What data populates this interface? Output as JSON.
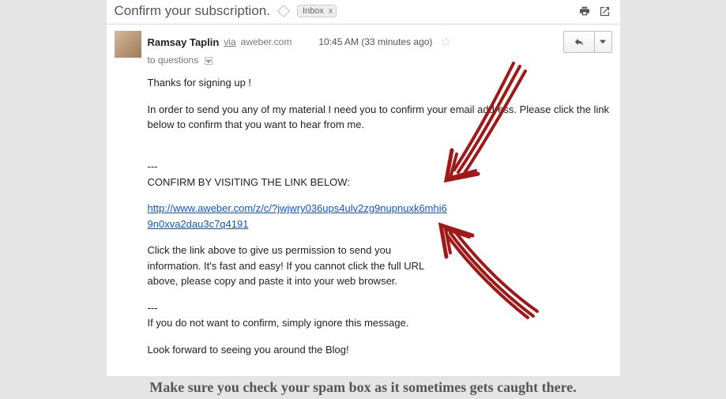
{
  "header": {
    "subject": "Confirm your subscription.",
    "inbox_label": "Inbox",
    "inbox_close": "x"
  },
  "sender": {
    "name": "Ramsay Taplin",
    "via_word": "via",
    "via_domain": "aweber.com",
    "timestamp": "10:45 AM (33 minutes ago)",
    "to_line": "to questions"
  },
  "body": {
    "greeting": "Thanks for signing up !",
    "intro": "In order to send you any of my material I need you to confirm your email address. Please click the link below to confirm that you want to hear from me.",
    "sep": "---",
    "confirm_heading": "CONFIRM BY VISITING THE LINK BELOW:",
    "link_text": "http://www.aweber.com/z/c/?jwjwry036ups4ulv2zg9nupnuxk6mhi69n0xva2dau3c7q4191",
    "instructions": "Click the link above to give us permission to send you information.  It's fast and easy!  If you cannot click the full URL above, please copy and paste it into your web browser.",
    "ignore": "If you do not want to confirm, simply ignore this message.",
    "closing": "Look forward to seeing you around the Blog!"
  },
  "caption": "Make sure you check your spam box as it sometimes gets caught there."
}
